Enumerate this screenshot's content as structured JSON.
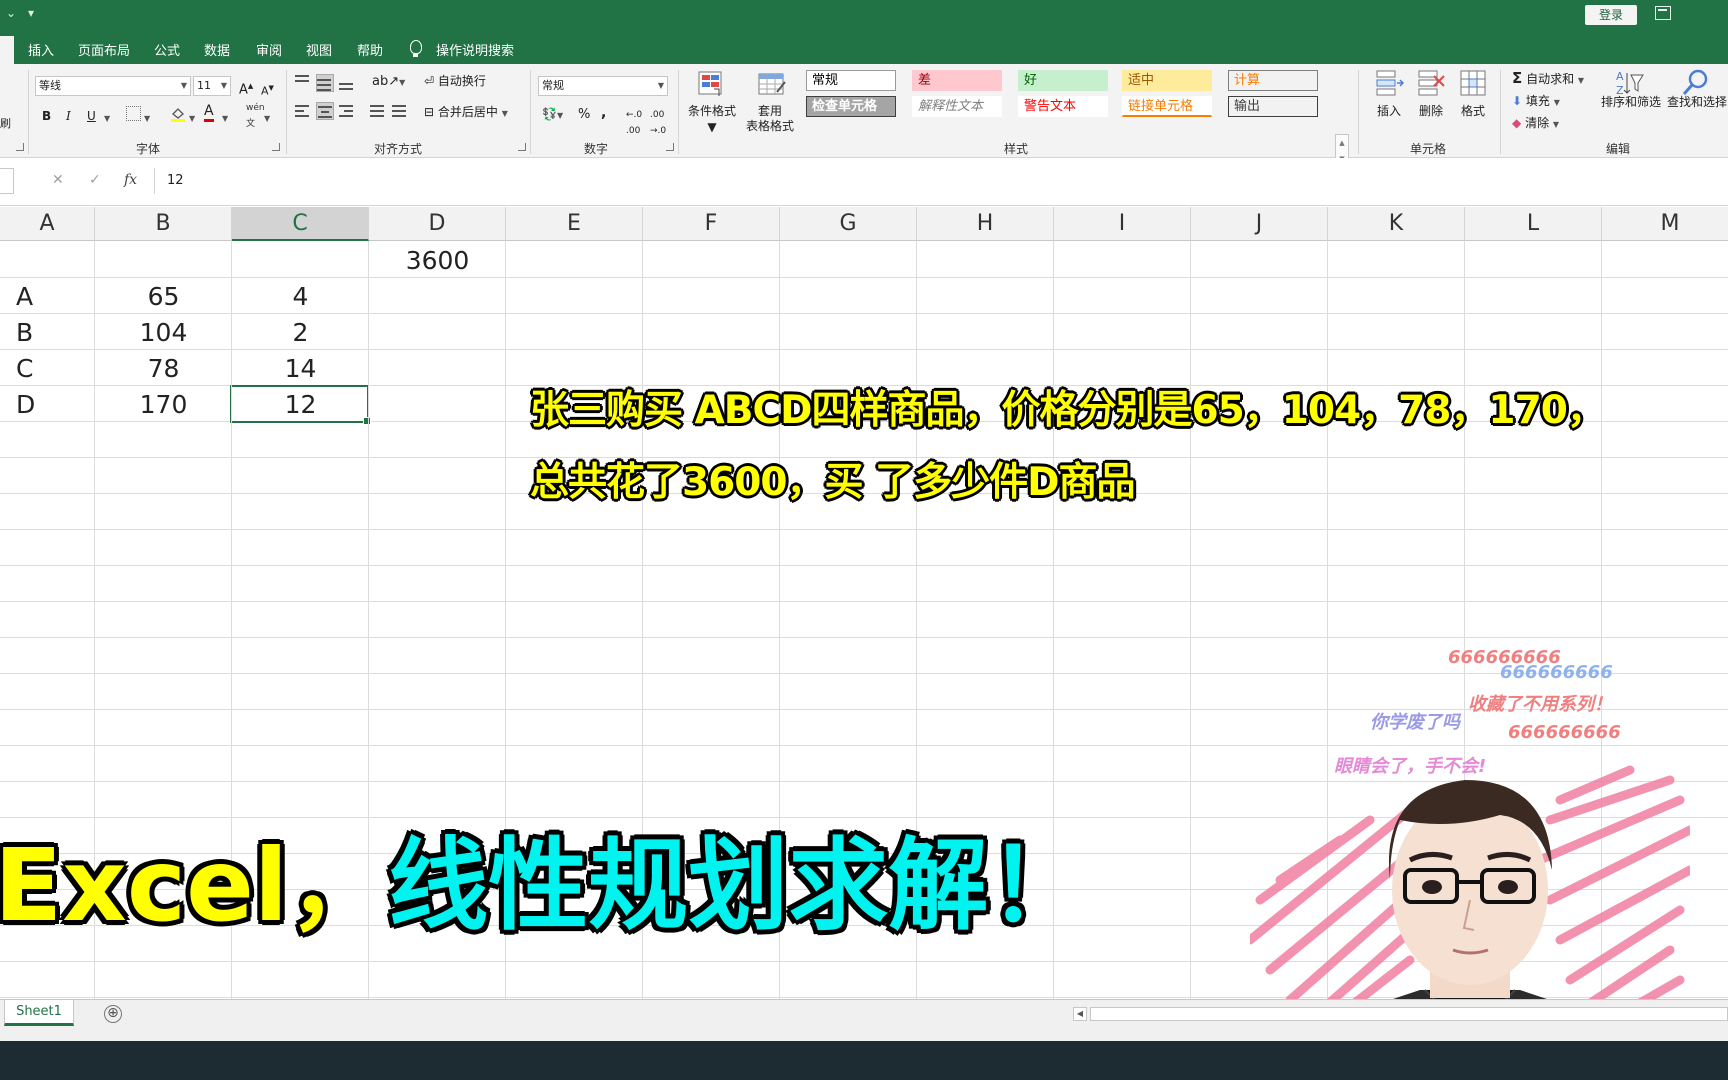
{
  "titlebar": {
    "login_label": "登录"
  },
  "ribbon_tabs": [
    "插入",
    "页面布局",
    "公式",
    "数据",
    "审阅",
    "视图",
    "帮助"
  ],
  "tell_me": "操作说明搜索",
  "font_group": {
    "font_name": "等线",
    "font_size": "11",
    "label": "字体",
    "bold": "B",
    "italic": "I",
    "underline": "U",
    "grow": "A",
    "shrink": "A",
    "wen": "wén"
  },
  "alignment_group": {
    "wrap_text": "自动换行",
    "merge_center": "合并后居中",
    "label": "对齐方式"
  },
  "number_group": {
    "format": "常规",
    "percent": "%",
    "comma": ",",
    "label": "数字"
  },
  "styles_group": {
    "conditional_format": "条件格式",
    "format_as_table_1": "套用",
    "format_as_table_2": "表格格式",
    "cells": [
      {
        "text": "常规",
        "fg": "#000000",
        "bg": "#ffffff",
        "border": "#9a9a9a"
      },
      {
        "text": "差",
        "fg": "#9c0006",
        "bg": "#ffc7ce",
        "border": "#ffc7ce"
      },
      {
        "text": "好",
        "fg": "#006100",
        "bg": "#c6efce",
        "border": "#c6efce"
      },
      {
        "text": "适中",
        "fg": "#9c5700",
        "bg": "#ffeb9c",
        "border": "#ffeb9c"
      },
      {
        "text": "计算",
        "fg": "#fa7d00",
        "bg": "#f2f2f2",
        "border": "#7f7f7f"
      },
      {
        "text": "检查单元格",
        "fg": "#ffffff",
        "bg": "#a5a5a5",
        "border": "#3f3f3f"
      },
      {
        "text": "解释性文本",
        "fg": "#7f7f7f",
        "bg": "#ffffff",
        "border": "#ffffff"
      },
      {
        "text": "警告文本",
        "fg": "#ff0000",
        "bg": "#ffffff",
        "border": "#ffffff"
      },
      {
        "text": "链接单元格",
        "fg": "#fa7d00",
        "bg": "#ffffff",
        "border": "#ffffff"
      },
      {
        "text": "输出",
        "fg": "#3f3f3f",
        "bg": "#f2f2f2",
        "border": "#3f3f3f"
      }
    ],
    "label": "样式"
  },
  "cells_group": {
    "insert": "插入",
    "delete": "删除",
    "format": "格式",
    "label": "单元格"
  },
  "editing_group": {
    "autosum": "自动求和",
    "fill": "填充",
    "clear": "清除",
    "sort_filter": "排序和筛选",
    "find_select": "查找和选择",
    "label": "编辑"
  },
  "formula_bar": {
    "cancel": "✕",
    "enter": "✓",
    "fx": "fx",
    "value": "12"
  },
  "columns": [
    "A",
    "B",
    "C",
    "D",
    "E",
    "F",
    "G",
    "H",
    "I",
    "J",
    "K",
    "L",
    "M"
  ],
  "selected_column": "C",
  "sheet": {
    "d1": "3600",
    "rows": [
      {
        "name": "A",
        "price": "65",
        "qty": "4"
      },
      {
        "name": "B",
        "price": "104",
        "qty": "2"
      },
      {
        "name": "C",
        "price": "78",
        "qty": "14"
      },
      {
        "name": "D",
        "price": "170",
        "qty": "12"
      }
    ]
  },
  "overlay": {
    "question_line1": "张三购买 ABCD四样商品，价格分别是65，104，78，170，",
    "question_line2": "总共花了3600，买 了多少件D商品",
    "title_part1": "Excel，",
    "title_part2": "线性规划求解！"
  },
  "danmu": [
    {
      "text": "666666666",
      "color": "#f08080"
    },
    {
      "text": "666666666",
      "color": "#8fb2ec"
    },
    {
      "text": "收藏了不用系列！",
      "color": "#f08080"
    },
    {
      "text": "你学废了吗",
      "color": "#9a9ae6"
    },
    {
      "text": "666666666",
      "color": "#f08080"
    },
    {
      "text": "眼睛会了，手不会!",
      "color": "#e58ad6"
    }
  ],
  "sheet_tabs": [
    "Sheet1"
  ],
  "add_sheet": "⊕"
}
